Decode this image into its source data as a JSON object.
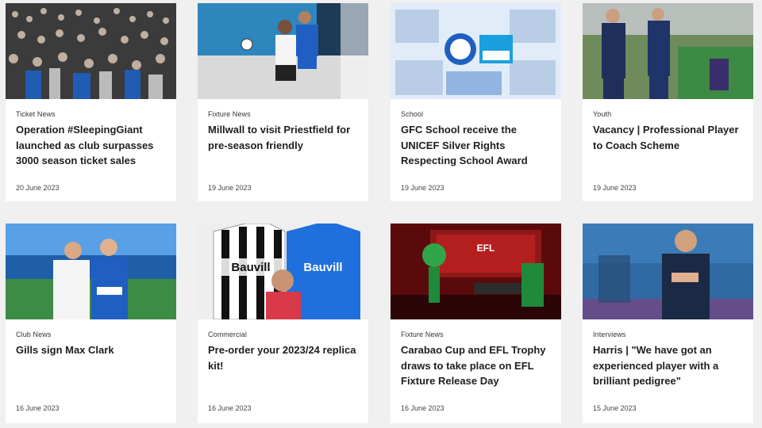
{
  "articles": [
    {
      "category": "Ticket News",
      "title": "Operation #SleepingGiant launched as club surpasses 3000 season ticket sales",
      "date": "20 June 2023",
      "image": "crowd-photo"
    },
    {
      "category": "Fixture News",
      "title": "Millwall to visit Priestfield for pre-season friendly",
      "date": "19 June 2023",
      "image": "match-action-photo"
    },
    {
      "category": "School",
      "title": "GFC School receive the UNICEF Silver Rights Respecting School Award",
      "date": "19 June 2023",
      "image": "school-collage-photo"
    },
    {
      "category": "Youth",
      "title": "Vacancy | Professional Player to Coach Scheme",
      "date": "19 June 2023",
      "image": "coaches-photo"
    },
    {
      "category": "Club News",
      "title": "Gills sign Max Clark",
      "date": "16 June 2023",
      "image": "signing-photo"
    },
    {
      "category": "Commercial",
      "title": "Pre-order your 2023/24 replica kit!",
      "date": "16 June 2023",
      "image": "replica-kit-photo",
      "sponsor_text": "Bauvill"
    },
    {
      "category": "Fixture News",
      "title": "Carabao Cup and EFL Trophy draws to take place on EFL Fixture Release Day",
      "date": "16 June 2023",
      "image": "efl-studio-photo",
      "screen_text": "EFL"
    },
    {
      "category": "Interviews",
      "title": "Harris | \"We have got an experienced player with a brilliant pedigree\"",
      "date": "15 June 2023",
      "image": "manager-photo"
    }
  ],
  "colors": {
    "page_bg": "#f0f0f0",
    "card_bg": "#ffffff",
    "gills_blue": "#1f5fc1"
  }
}
